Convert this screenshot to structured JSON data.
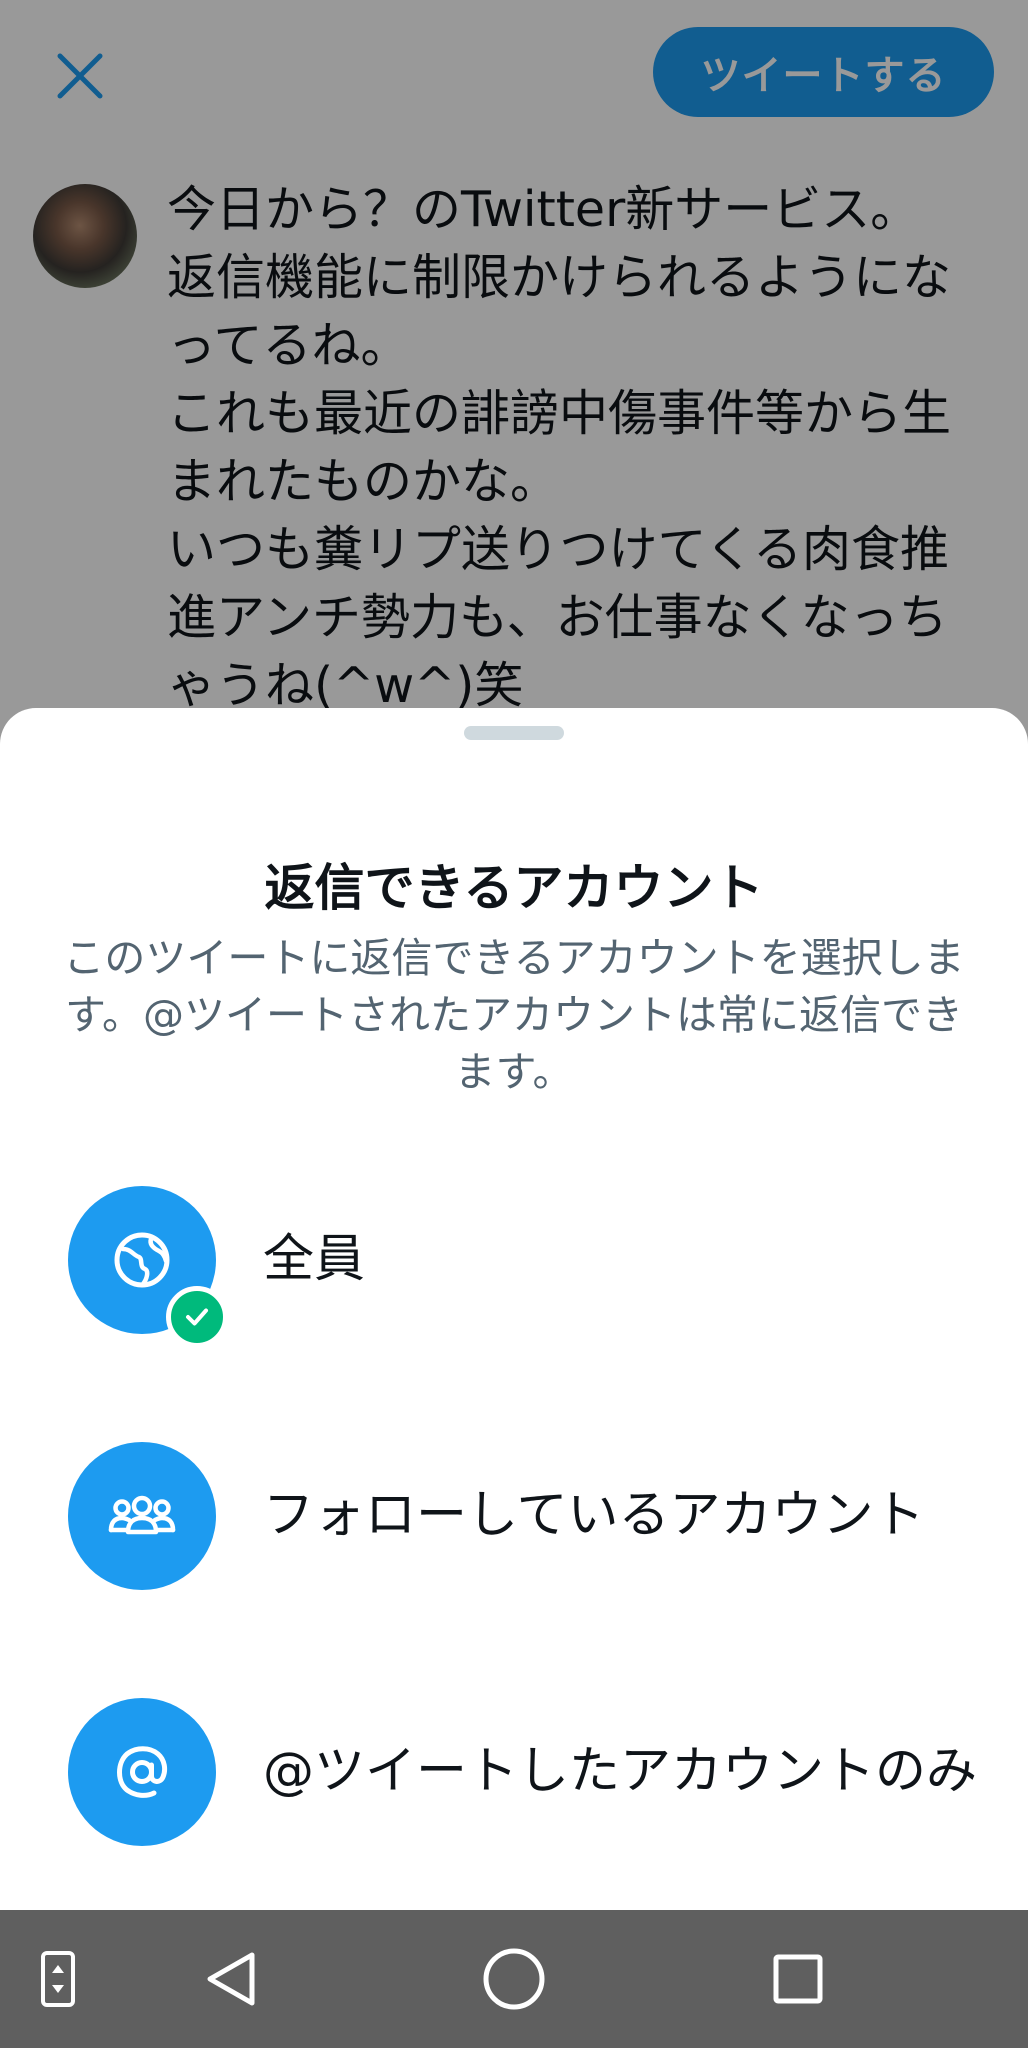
{
  "composer": {
    "tweet_button_label": "ツイートする",
    "tweet_text": "今日から？のTwitter新サービス。\n返信機能に制限かけられるようにな\nってるね。\nこれも最近の誹謗中傷事件等から生\nまれたものかな。\nいつも糞リプ送りつけてくる肉食推\n進アンチ勢力も、お仕事なくなっち\nゃうね(^w^)笑",
    "close_icon": "close-icon",
    "avatar": "user-avatar"
  },
  "reply_sheet": {
    "title": "返信できるアカウント",
    "description": "このツイートに返信できるアカウントを選択します。@ツイートされたアカウントは常に返信できます。",
    "options": [
      {
        "label": "全員",
        "icon": "globe-icon",
        "selected": true
      },
      {
        "label": "フォローしているアカウント",
        "icon": "people-icon",
        "selected": false
      },
      {
        "label": "@ツイートしたアカウントのみ",
        "icon": "at-sign-icon",
        "selected": false
      }
    ],
    "selected_icon": "check-icon"
  },
  "nav_bar": {
    "buttons": [
      "screen-rotate-icon",
      "back-icon",
      "home-icon",
      "recents-icon"
    ]
  },
  "colors": {
    "accent": "#1d9bf0",
    "check": "#00ba7c",
    "navbar": "#5f5f5f"
  }
}
